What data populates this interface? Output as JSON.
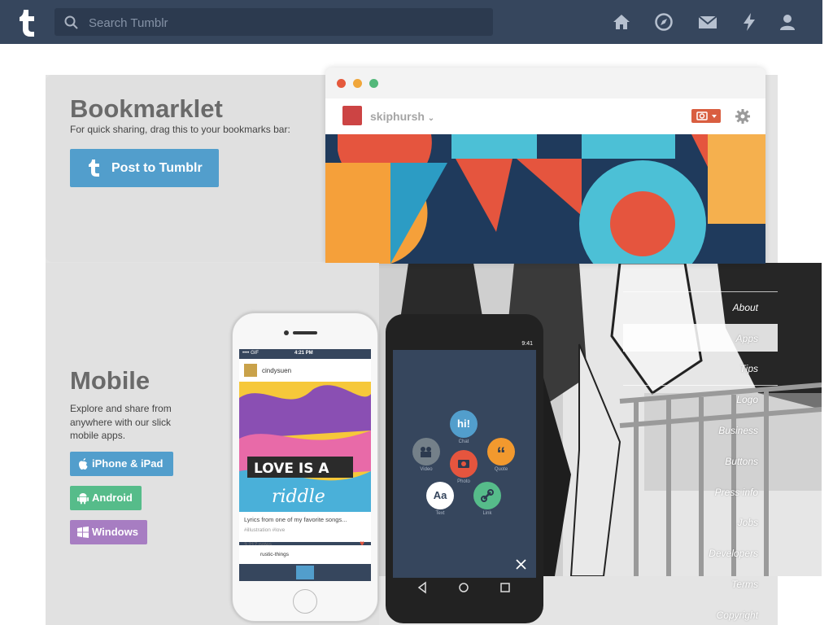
{
  "search": {
    "placeholder": "Search Tumblr"
  },
  "nav": {
    "icons": [
      "home-icon",
      "explore-icon",
      "inbox-icon",
      "activity-icon",
      "account-icon"
    ]
  },
  "bookmarklet": {
    "title": "Bookmarklet",
    "subtitle": "For quick sharing, drag this to your bookmarks bar:",
    "button_label": "Post to Tumblr",
    "button_color": "#529ecc"
  },
  "browser_mock": {
    "username": "skiphursh"
  },
  "mobile": {
    "title": "Mobile",
    "description": "Explore and share from anywhere with our slick mobile apps.",
    "apps": [
      {
        "label": "iPhone & iPad",
        "icon": "apple-icon",
        "color": "#529ecc"
      },
      {
        "label": "Android",
        "icon": "android-icon",
        "color": "#56bc8a"
      },
      {
        "label": "Windows",
        "icon": "windows-icon",
        "color": "#a77dc2"
      }
    ]
  },
  "iphone_mock": {
    "time": "4:21 PM",
    "carrier": "•••• GIF",
    "post_user": "cindysuen",
    "caption": "Lyrics from one of my favorite songs...",
    "tags": "#illustration  #love",
    "notes": "3,217 notes",
    "next_user": "rustic-things"
  },
  "android_mock": {
    "time": "9:41",
    "options": [
      {
        "label": "Chat",
        "glyph": "hi!"
      },
      {
        "label": "Video",
        "glyph": ""
      },
      {
        "label": "Quote",
        "glyph": "“"
      },
      {
        "label": "Photo",
        "glyph": ""
      },
      {
        "label": "Text",
        "glyph": "Aa"
      },
      {
        "label": "Link",
        "glyph": ""
      }
    ]
  },
  "footer": {
    "links": [
      "About",
      "Apps",
      "Tips",
      "Logo",
      "Business",
      "Buttons",
      "Press info",
      "Jobs",
      "Developers",
      "Terms",
      "Copyright"
    ]
  },
  "colors": {
    "navbar": "#36465d",
    "brand_blue": "#529ecc"
  }
}
